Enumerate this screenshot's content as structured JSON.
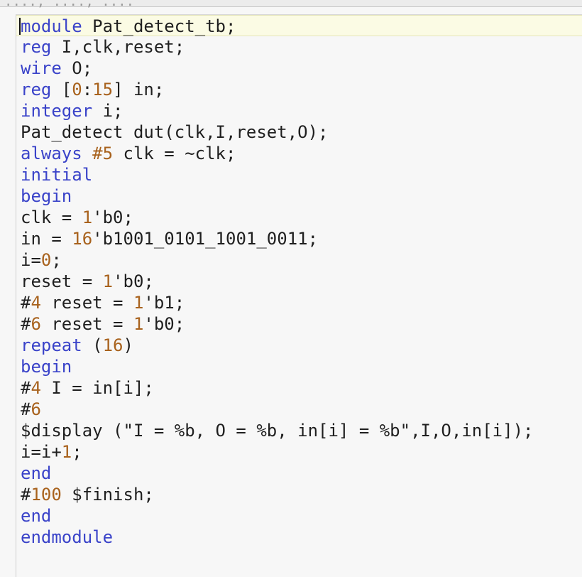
{
  "editor": {
    "top_strip_text": "...., ...., ....",
    "lines": [
      [
        [
          "kw",
          "module"
        ],
        [
          "t",
          " Pat_detect_tb;"
        ]
      ],
      [
        [
          "kw",
          "reg"
        ],
        [
          "t",
          " I,clk,reset;"
        ]
      ],
      [
        [
          "kw",
          "wire"
        ],
        [
          "t",
          " O;"
        ]
      ],
      [
        [
          "kw",
          "reg"
        ],
        [
          "t",
          " ["
        ],
        [
          "num",
          "0"
        ],
        [
          "t",
          ":"
        ],
        [
          "num",
          "15"
        ],
        [
          "t",
          "] in;"
        ]
      ],
      [
        [
          "kw",
          "integer"
        ],
        [
          "t",
          " i;"
        ]
      ],
      [
        [
          "t",
          "Pat_detect dut(clk,I,reset,O);"
        ]
      ],
      [
        [
          "kw",
          "always"
        ],
        [
          "t",
          " "
        ],
        [
          "num",
          "#5"
        ],
        [
          "t",
          " clk = ~clk;"
        ]
      ],
      [
        [
          "kw",
          "initial"
        ]
      ],
      [
        [
          "kw",
          "begin"
        ]
      ],
      [
        [
          "t",
          "clk = "
        ],
        [
          "num",
          "1"
        ],
        [
          "t",
          "'b0;"
        ]
      ],
      [
        [
          "t",
          "in = "
        ],
        [
          "num",
          "16"
        ],
        [
          "t",
          "'b1001_0101_1001_0011;"
        ]
      ],
      [
        [
          "t",
          "i="
        ],
        [
          "num",
          "0"
        ],
        [
          "t",
          ";"
        ]
      ],
      [
        [
          "t",
          "reset = "
        ],
        [
          "num",
          "1"
        ],
        [
          "t",
          "'b0;"
        ]
      ],
      [
        [
          "t",
          "#"
        ],
        [
          "num",
          "4"
        ],
        [
          "t",
          " reset = "
        ],
        [
          "num",
          "1"
        ],
        [
          "t",
          "'b1;"
        ]
      ],
      [
        [
          "t",
          "#"
        ],
        [
          "num",
          "6"
        ],
        [
          "t",
          " reset = "
        ],
        [
          "num",
          "1"
        ],
        [
          "t",
          "'b0;"
        ]
      ],
      [
        [
          "kw",
          "repeat"
        ],
        [
          "t",
          " ("
        ],
        [
          "num",
          "16"
        ],
        [
          "t",
          ")"
        ]
      ],
      [
        [
          "kw",
          "begin"
        ]
      ],
      [
        [
          "t",
          "#"
        ],
        [
          "num",
          "4"
        ],
        [
          "t",
          " I = in[i];"
        ]
      ],
      [
        [
          "t",
          "#"
        ],
        [
          "num",
          "6"
        ]
      ],
      [
        [
          "t",
          "$display (\"I = %b, O = %b, in[i] = %b\",I,O,in[i]);"
        ]
      ],
      [
        [
          "t",
          "i=i+"
        ],
        [
          "num",
          "1"
        ],
        [
          "t",
          ";"
        ]
      ],
      [
        [
          "kw",
          "end"
        ]
      ],
      [
        [
          "t",
          "#"
        ],
        [
          "num",
          "100"
        ],
        [
          "t",
          " $finish;"
        ]
      ],
      [
        [
          "kw",
          "end"
        ]
      ],
      [
        [
          "kw",
          "endmodule"
        ]
      ]
    ]
  }
}
